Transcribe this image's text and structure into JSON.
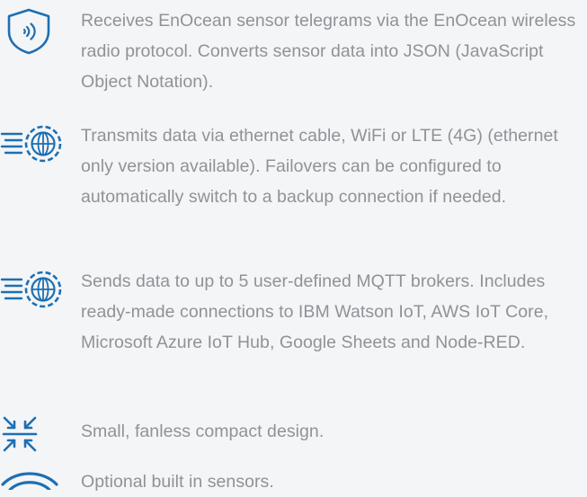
{
  "features": [
    {
      "icon": "radio-signal-shield-icon",
      "text": "Receives EnOcean sensor telegrams via the EnOcean wireless radio protocol. Converts sensor data into JSON (JavaScript Object Notation)."
    },
    {
      "icon": "globe-gear-network-icon",
      "text": "Transmits data via ethernet cable, WiFi or LTE (4G) (ethernet only version available). Failovers can be configured to automatically switch to a backup connection if needed."
    },
    {
      "icon": "globe-gear-network-icon",
      "text": "Sends data to up to 5 user-defined MQTT brokers. Includes ready-made connections to IBM Watson IoT, AWS IoT Core, Microsoft Azure IoT Hub, Google Sheets  and Node-RED."
    },
    {
      "icon": "compact-arrows-icon",
      "text": "Small, fanless compact design."
    },
    {
      "icon": "wireless-waves-icon",
      "text": "Optional built in sensors."
    }
  ],
  "colors": {
    "icon": "#1d6fb3",
    "text": "#8f9297",
    "background": "#f4f5f7"
  }
}
